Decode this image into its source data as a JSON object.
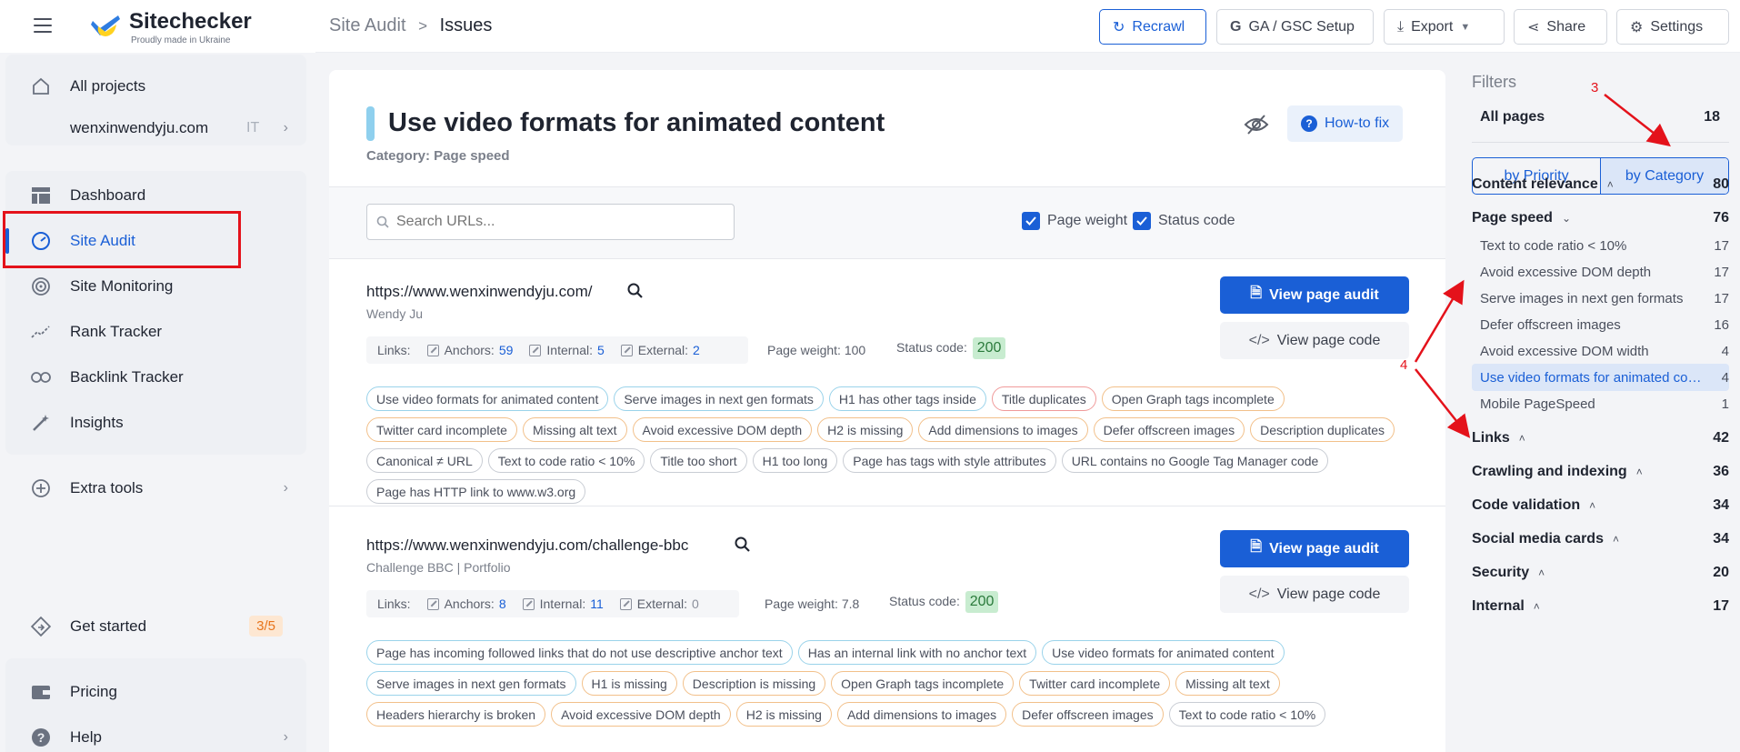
{
  "app": {
    "brand": "Sitechecker",
    "tagline": "Proudly made in Ukraine"
  },
  "sidebar": {
    "items": [
      {
        "name": "all-projects",
        "label": "All projects"
      },
      {
        "name": "project",
        "label": "wenxinwendyju.com",
        "suffix": "IT"
      },
      {
        "name": "dashboard",
        "label": "Dashboard"
      },
      {
        "name": "site-audit",
        "label": "Site Audit"
      },
      {
        "name": "site-monitoring",
        "label": "Site Monitoring"
      },
      {
        "name": "rank-tracker",
        "label": "Rank Tracker"
      },
      {
        "name": "backlink-tracker",
        "label": "Backlink Tracker"
      },
      {
        "name": "insights",
        "label": "Insights"
      },
      {
        "name": "extra-tools",
        "label": "Extra tools"
      },
      {
        "name": "get-started",
        "label": "Get started",
        "badge": "3/5"
      },
      {
        "name": "pricing",
        "label": "Pricing"
      },
      {
        "name": "help",
        "label": "Help"
      }
    ]
  },
  "header": {
    "breadcrumb_parent": "Site Audit",
    "breadcrumb_sep": ">",
    "breadcrumb_current": "Issues",
    "buttons": {
      "recrawl": "Recrawl",
      "ga_gsc": "GA / GSC Setup",
      "export": "Export",
      "share": "Share",
      "settings": "Settings"
    }
  },
  "issue": {
    "title": "Use video formats for animated content",
    "category": "Category: Page speed",
    "how_to_fix": "How-to fix",
    "search_placeholder": "Search URLs...",
    "checkbox_page_weight": "Page weight",
    "checkbox_status_code": "Status code"
  },
  "pages": [
    {
      "url": "https://www.wenxinwendyju.com/",
      "title": "Wendy Ju",
      "links_label": "Links:",
      "anchors_label": "Anchors:",
      "anchors": "59",
      "internal_label": "Internal:",
      "internal": "5",
      "external_label": "External:",
      "external": "2",
      "page_weight": "Page weight: 100",
      "status_label": "Status code:",
      "status": "200",
      "view_audit": "View page audit",
      "view_code": "View page code",
      "tags": [
        {
          "t": "Use video formats for animated content",
          "c": "blue"
        },
        {
          "t": "Serve images in next gen formats",
          "c": "blue"
        },
        {
          "t": "H1 has other tags inside",
          "c": "blue"
        },
        {
          "t": "Title duplicates",
          "c": "red"
        },
        {
          "t": "Open Graph tags incomplete",
          "c": "orange"
        },
        {
          "t": "Twitter card incomplete",
          "c": "orange"
        },
        {
          "t": "Missing alt text",
          "c": "orange"
        },
        {
          "t": "Avoid excessive DOM depth",
          "c": "orange"
        },
        {
          "t": "H2 is missing",
          "c": "orange"
        },
        {
          "t": "Add dimensions to images",
          "c": "orange"
        },
        {
          "t": "Defer offscreen images",
          "c": "orange"
        },
        {
          "t": "Description duplicates",
          "c": "orange"
        },
        {
          "t": "Canonical ≠ URL",
          "c": "gray"
        },
        {
          "t": "Text to code ratio < 10%",
          "c": "gray"
        },
        {
          "t": "Title too short",
          "c": "gray"
        },
        {
          "t": "H1 too long",
          "c": "gray"
        },
        {
          "t": "Page has tags with style attributes",
          "c": "gray"
        },
        {
          "t": "URL contains no Google Tag Manager code",
          "c": "gray"
        },
        {
          "t": "Page has HTTP link to www.w3.org",
          "c": "gray"
        }
      ]
    },
    {
      "url": "https://www.wenxinwendyju.com/challenge-bbc",
      "title": "Challenge BBC | Portfolio",
      "links_label": "Links:",
      "anchors_label": "Anchors:",
      "anchors": "8",
      "internal_label": "Internal:",
      "internal": "11",
      "external_label": "External:",
      "external": "0",
      "page_weight": "Page weight: 7.8",
      "status_label": "Status code:",
      "status": "200",
      "view_audit": "View page audit",
      "view_code": "View page code",
      "tags": [
        {
          "t": "Page has incoming followed links that do not use descriptive anchor text",
          "c": "blue"
        },
        {
          "t": "Has an internal link with no anchor text",
          "c": "blue"
        },
        {
          "t": "Use video formats for animated content",
          "c": "blue"
        },
        {
          "t": "Serve images in next gen formats",
          "c": "blue"
        },
        {
          "t": "H1 is missing",
          "c": "orange"
        },
        {
          "t": "Description is missing",
          "c": "orange"
        },
        {
          "t": "Open Graph tags incomplete",
          "c": "orange"
        },
        {
          "t": "Twitter card incomplete",
          "c": "orange"
        },
        {
          "t": "Missing alt text",
          "c": "orange"
        },
        {
          "t": "Headers hierarchy is broken",
          "c": "orange"
        },
        {
          "t": "Avoid excessive DOM depth",
          "c": "orange"
        },
        {
          "t": "H2 is missing",
          "c": "orange"
        },
        {
          "t": "Add dimensions to images",
          "c": "orange"
        },
        {
          "t": "Defer offscreen images",
          "c": "orange"
        },
        {
          "t": "Text to code ratio < 10%",
          "c": "gray"
        }
      ]
    }
  ],
  "filters": {
    "label": "Filters",
    "all_pages": "All pages",
    "all_pages_count": "18",
    "by_priority": "by Priority",
    "by_category": "by Category",
    "categories": [
      {
        "label": "Content relevance",
        "count": "80",
        "expanded": false
      },
      {
        "label": "Page speed",
        "count": "76",
        "expanded": true,
        "items": [
          {
            "label": "Text to code ratio < 10%",
            "count": "17"
          },
          {
            "label": "Avoid excessive DOM depth",
            "count": "17"
          },
          {
            "label": "Serve images in next gen formats",
            "count": "17"
          },
          {
            "label": "Defer offscreen images",
            "count": "16"
          },
          {
            "label": "Avoid excessive DOM width",
            "count": "4"
          },
          {
            "label": "Use video formats for animated content",
            "count": "4",
            "selected": true
          },
          {
            "label": "Mobile PageSpeed",
            "count": "1"
          }
        ]
      },
      {
        "label": "Links",
        "count": "42",
        "expanded": false
      },
      {
        "label": "Crawling and indexing",
        "count": "36",
        "expanded": false
      },
      {
        "label": "Code validation",
        "count": "34",
        "expanded": false
      },
      {
        "label": "Social media cards",
        "count": "34",
        "expanded": false
      },
      {
        "label": "Security",
        "count": "20",
        "expanded": false
      },
      {
        "label": "Internal",
        "count": "17",
        "expanded": false
      }
    ]
  },
  "annotations": {
    "a3": "3",
    "a4": "4"
  },
  "colors": {
    "accent": "#1a5fd6",
    "annotation": "#e4121b"
  }
}
